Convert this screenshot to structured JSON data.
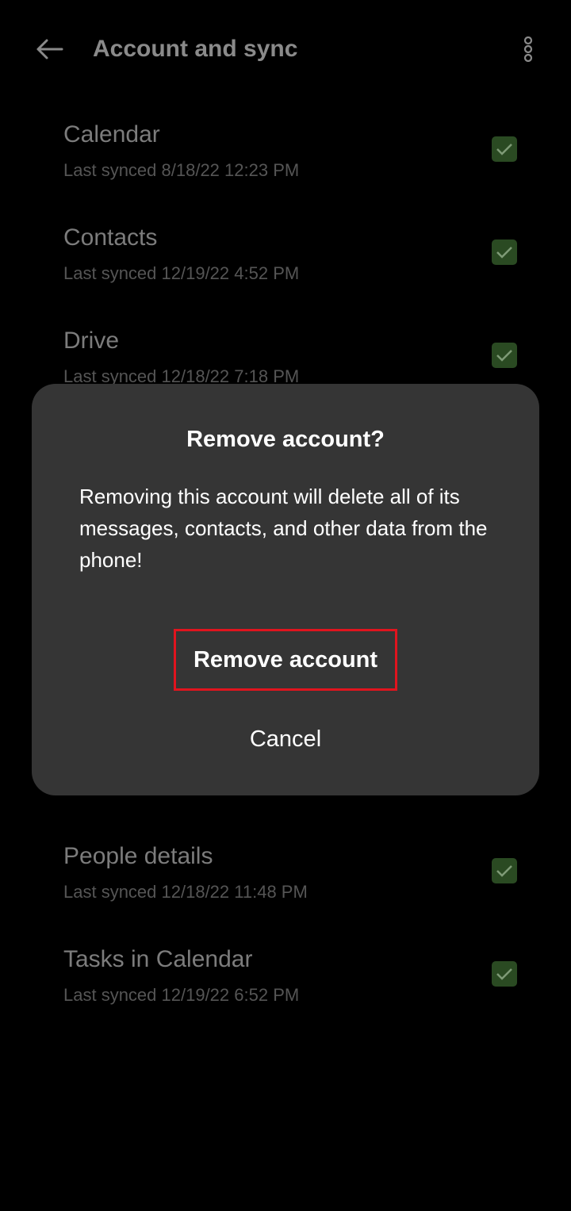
{
  "header": {
    "title": "Account and sync"
  },
  "sync_items": [
    {
      "title": "Calendar",
      "subtitle": "Last synced 8/18/22 12:23 PM"
    },
    {
      "title": "Contacts",
      "subtitle": "Last synced 12/19/22 4:52 PM"
    },
    {
      "title": "Drive",
      "subtitle": "Last synced 12/18/22 7:18 PM"
    },
    {
      "title": "People details",
      "subtitle": "Last synced 12/18/22 11:48 PM"
    },
    {
      "title": "Tasks in Calendar",
      "subtitle": "Last synced 12/19/22 6:52 PM"
    }
  ],
  "dialog": {
    "title": "Remove account?",
    "message": "Removing this account will delete all of its messages, contacts, and other data from the phone!",
    "confirm_label": "Remove account",
    "cancel_label": "Cancel"
  },
  "colors": {
    "background": "#000000",
    "dialog": "#353535",
    "checkbox": "#2a4a22",
    "highlight": "#e0141e"
  }
}
